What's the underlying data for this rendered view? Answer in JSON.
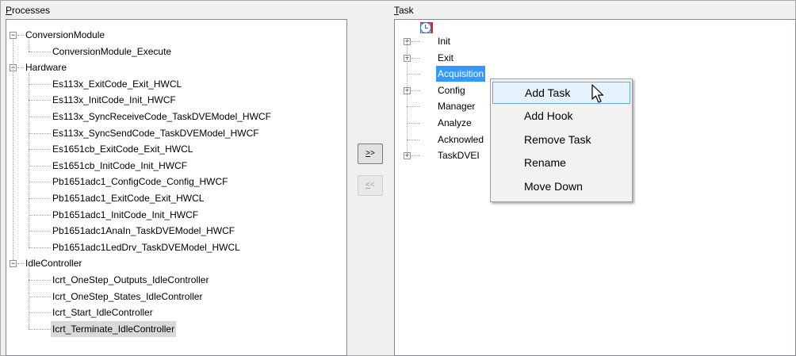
{
  "processes": {
    "header": "Processes",
    "header_mnemonic": "P",
    "header_rest": "rocesses",
    "groups": [
      {
        "label": "ConversionModule",
        "items": [
          "ConversionModule_Execute"
        ]
      },
      {
        "label": "Hardware",
        "items": [
          "Es113x_ExitCode_Exit_HWCL",
          "Es113x_InitCode_Init_HWCF",
          "Es113x_SyncReceiveCode_TaskDVEModel_HWCF",
          "Es113x_SyncSendCode_TaskDVEModel_HWCF",
          "Es1651cb_ExitCode_Exit_HWCL",
          "Es1651cb_InitCode_Init_HWCF",
          "Pb1651adc1_ConfigCode_Config_HWCF",
          "Pb1651adc1_ExitCode_Exit_HWCL",
          "Pb1651adc1_InitCode_Init_HWCF",
          "Pb1651adc1AnaIn_TaskDVEModel_HWCF",
          "Pb1651adc1LedDrv_TaskDVEModel_HWCL"
        ]
      },
      {
        "label": "IdleController",
        "items": [
          "Icrt_OneStep_Outputs_IdleController",
          "Icrt_OneStep_States_IdleController",
          "Icrt_Start_IdleController",
          "Icrt_Terminate_IdleController"
        ]
      }
    ],
    "selected_item": "Icrt_Terminate_IdleController"
  },
  "buttons": {
    "add": {
      "mnemonic": ">",
      "rest": ">"
    },
    "remove": {
      "mnemonic": "<",
      "rest": "<"
    }
  },
  "task": {
    "header_mnemonic": "T",
    "header_rest": "ask",
    "items": [
      {
        "label": "Init",
        "icon": "init-icon",
        "expandable": true
      },
      {
        "label": "Exit",
        "icon": "exit-icon",
        "expandable": true
      },
      {
        "label": "Acquisition",
        "icon": "timer-icon",
        "expandable": false,
        "selected": true
      },
      {
        "label": "Config",
        "icon": "timer-icon",
        "expandable": true
      },
      {
        "label": "Manager",
        "icon": "timer-icon",
        "expandable": false
      },
      {
        "label": "Analyze",
        "icon": "task-box-icon",
        "expandable": false
      },
      {
        "label": "Acknowled",
        "icon": "task-box-icon",
        "expandable": false
      },
      {
        "label": "TaskDVEI",
        "icon": "timer-icon",
        "expandable": true
      }
    ]
  },
  "context_menu": {
    "items": [
      "Add Task",
      "Add Hook",
      "Remove Task",
      "Rename",
      "Move Down"
    ],
    "hovered": "Add Task"
  },
  "colors": {
    "selection_blue": "#3399ff",
    "selection_grey": "#d9d9d9",
    "menu_hover": "#e5f1fb",
    "init_green": "#1fa532",
    "exit_red": "#d02626",
    "timer_blue": "#2f6fb6"
  }
}
